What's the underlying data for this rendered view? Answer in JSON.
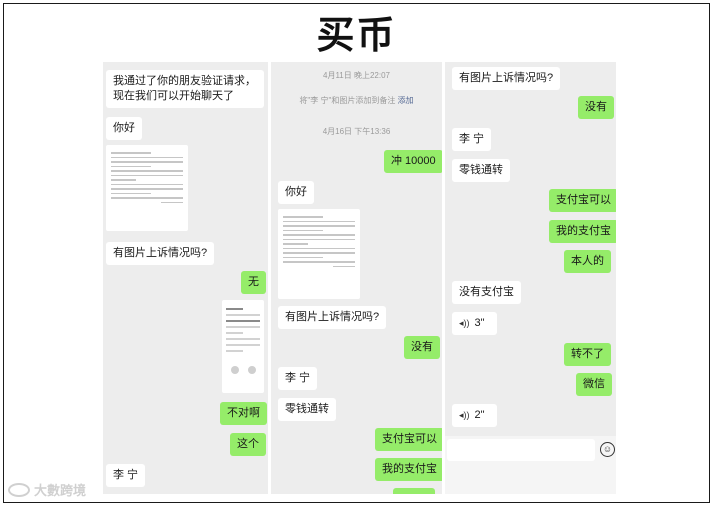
{
  "title": "买币",
  "left_panel": {
    "messages": [
      {
        "side": "in",
        "text": "我通过了你的朋友验证请求，现在我们可以开始聊天了"
      },
      {
        "side": "in",
        "text": "你好"
      },
      {
        "side": "in",
        "text": "有图片上诉情况吗?"
      },
      {
        "side": "out",
        "text": "无"
      },
      {
        "side": "out",
        "text": "不对啊"
      },
      {
        "side": "out",
        "text": "这个"
      },
      {
        "side": "in",
        "text": "李  宁"
      }
    ]
  },
  "middle_panel": {
    "timestamp_1": "4月11日 晚上22:07",
    "system_note": {
      "prefix": "将\"李  宁\"和图片添加到备注",
      "link": "添加"
    },
    "timestamp_2": "4月16日 下午13:36",
    "messages": [
      {
        "side": "out",
        "text": "冲 10000"
      },
      {
        "side": "in",
        "text": "你好"
      },
      {
        "side": "in",
        "text": "有图片上诉情况吗?"
      },
      {
        "side": "out",
        "text": "没有"
      },
      {
        "side": "in",
        "text": "李  宁"
      },
      {
        "side": "in",
        "text": "零钱通转"
      },
      {
        "side": "out",
        "text": "支付宝可以"
      },
      {
        "side": "out",
        "text": "我的支付宝"
      }
    ]
  },
  "right_panel": {
    "messages": [
      {
        "side": "in",
        "text": "有图片上诉情况吗?"
      },
      {
        "side": "out",
        "text": "没有"
      },
      {
        "side": "in",
        "text": "李  宁"
      },
      {
        "side": "in",
        "text": "零钱通转"
      },
      {
        "side": "out",
        "text": "支付宝可以"
      },
      {
        "side": "out",
        "text": "我的支付宝"
      },
      {
        "side": "out",
        "text": "本人的"
      },
      {
        "side": "in",
        "text": "没有支付宝"
      },
      {
        "side": "in",
        "voice": "3\"",
        "text": ""
      },
      {
        "side": "out",
        "text": "转不了"
      },
      {
        "side": "out",
        "text": "微信"
      },
      {
        "side": "in",
        "voice": "2\"",
        "text": ""
      }
    ]
  },
  "watermark": "大數跨境",
  "colors": {
    "outgoing": "#95ec69",
    "incoming": "#ffffff",
    "panel": "#ededed"
  }
}
